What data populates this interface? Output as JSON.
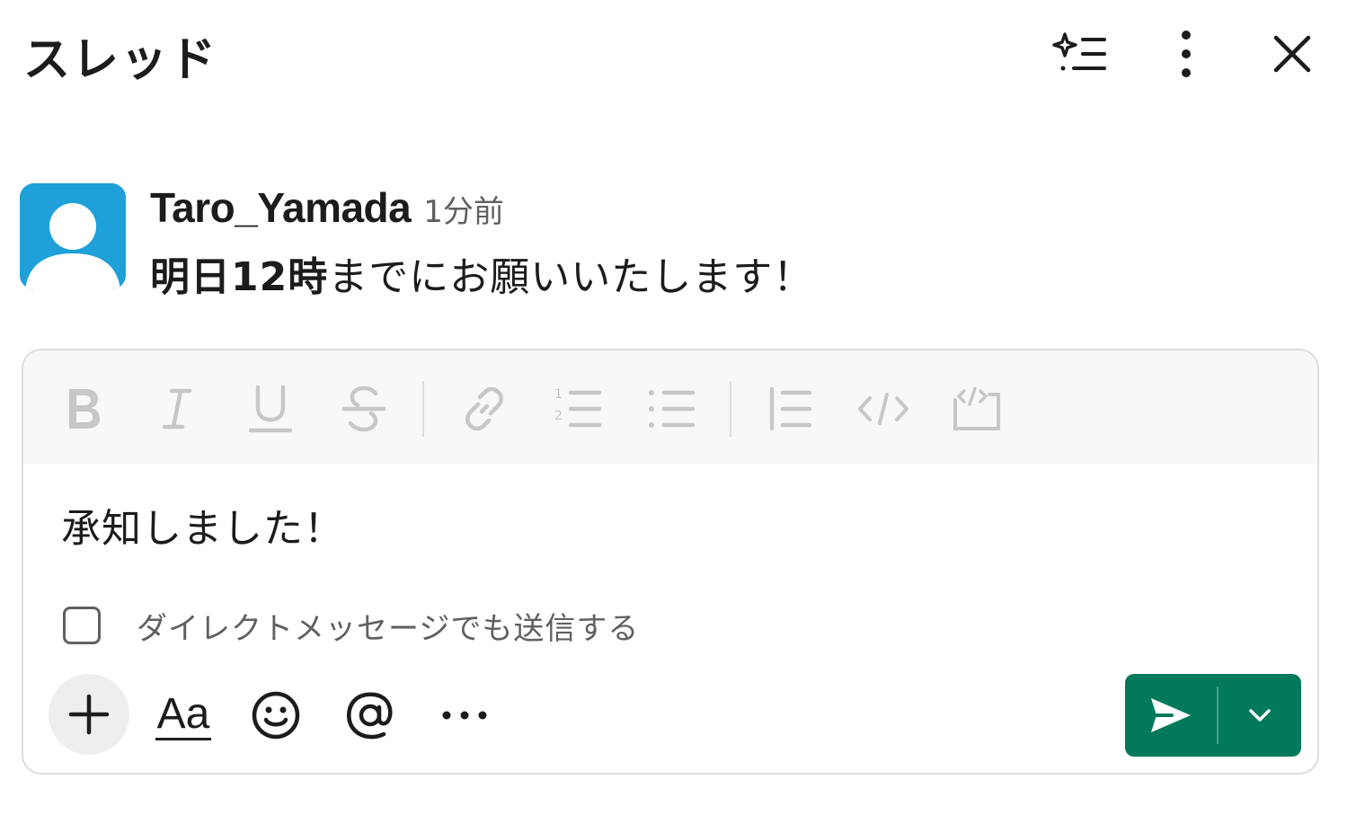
{
  "header": {
    "title": "スレッド",
    "icons": [
      "ai-summary-icon",
      "more-vertical-icon",
      "close-icon"
    ]
  },
  "message": {
    "author": "Taro_Yamada",
    "time": "1分前",
    "body_bold": "明日12時",
    "body_rest": "までにお願いいたします！",
    "avatar_color": "#1fa0d8"
  },
  "composer": {
    "toolbar_icons": [
      "bold-icon",
      "italic-icon",
      "underline-icon",
      "strikethrough-icon",
      "link-icon",
      "ordered-list-icon",
      "bulleted-list-icon",
      "blockquote-icon",
      "code-icon",
      "code-block-icon"
    ],
    "draft_text": "承知しました！",
    "also_send_label": "ダイレクトメッセージでも送信する",
    "also_send_checked": false,
    "format_label": "Aa",
    "bottom_icons": [
      "plus-icon",
      "format-icon",
      "emoji-icon",
      "mention-icon",
      "more-horizontal-icon",
      "send-icon",
      "chevron-down-icon"
    ],
    "send_color": "#007a5a"
  }
}
